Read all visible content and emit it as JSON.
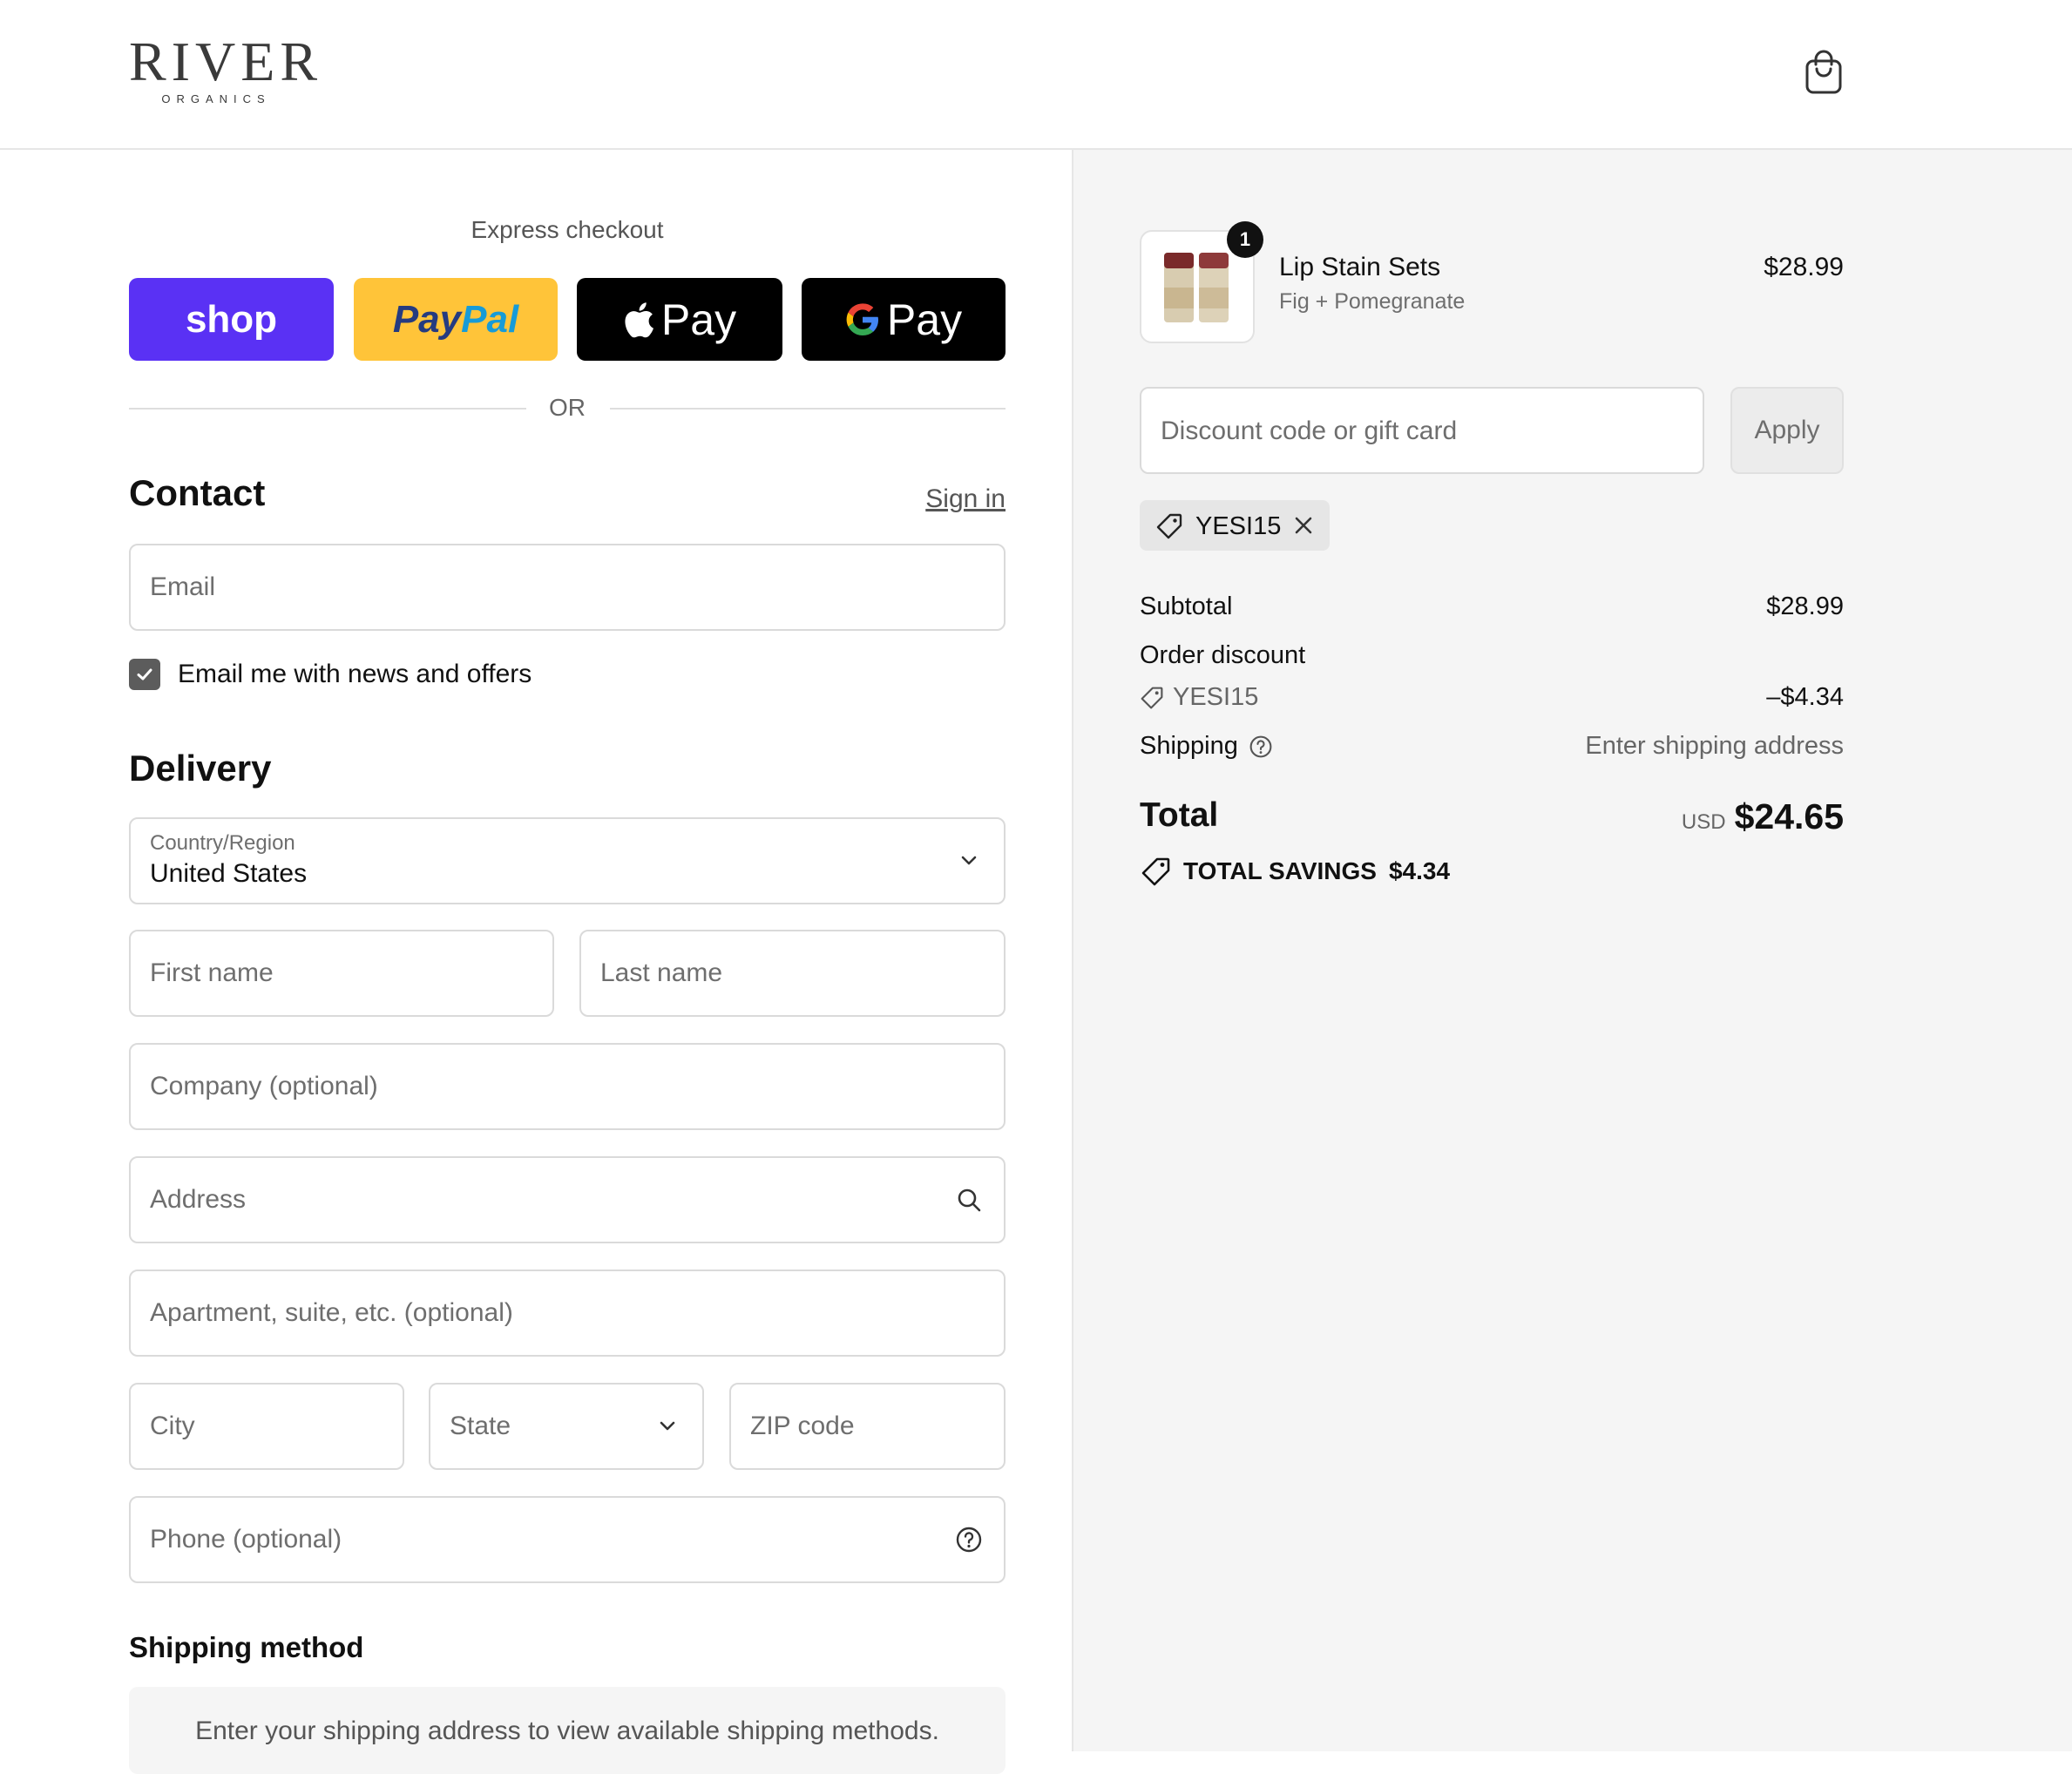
{
  "header": {
    "logo_main": "RIVER",
    "logo_sub": "ORGANICS",
    "cart_icon": "shopping-bag-icon"
  },
  "express": {
    "label": "Express checkout",
    "shop_label": "shop",
    "paypal_label_a": "Pay",
    "paypal_label_b": "Pal",
    "apple_label": "Pay",
    "google_label": "Pay",
    "or_text": "OR"
  },
  "contact": {
    "title": "Contact",
    "sign_in": "Sign in",
    "email_placeholder": "Email",
    "newsletter_label": "Email me with news and offers",
    "newsletter_checked": true
  },
  "delivery": {
    "title": "Delivery",
    "country_label": "Country/Region",
    "country_value": "United States",
    "first_name_placeholder": "First name",
    "last_name_placeholder": "Last name",
    "company_placeholder": "Company (optional)",
    "address_placeholder": "Address",
    "apartment_placeholder": "Apartment, suite, etc. (optional)",
    "city_placeholder": "City",
    "state_placeholder": "State",
    "zip_placeholder": "ZIP code",
    "phone_placeholder": "Phone (optional)"
  },
  "shipping_method": {
    "title": "Shipping method",
    "notice": "Enter your shipping address to view available shipping methods."
  },
  "summary": {
    "product": {
      "name": "Lip Stain Sets",
      "variant": "Fig + Pomegranate",
      "price": "$28.99",
      "quantity": "1"
    },
    "discount_placeholder": "Discount code or gift card",
    "apply_label": "Apply",
    "applied_code": "YESI15",
    "subtotal_label": "Subtotal",
    "subtotal_value": "$28.99",
    "order_discount_label": "Order discount",
    "order_discount_code": "YESI15",
    "order_discount_value": "–$4.34",
    "shipping_label": "Shipping",
    "shipping_value": "Enter shipping address",
    "total_label": "Total",
    "total_currency": "USD",
    "total_value": "$24.65",
    "savings_label": "TOTAL SAVINGS",
    "savings_value": "$4.34"
  },
  "colors": {
    "shop_purple": "#5a31f4",
    "paypal_yellow": "#ffc439",
    "paypal_navy": "#253b80",
    "paypal_blue": "#179bd7",
    "summary_bg": "#f5f5f5"
  }
}
